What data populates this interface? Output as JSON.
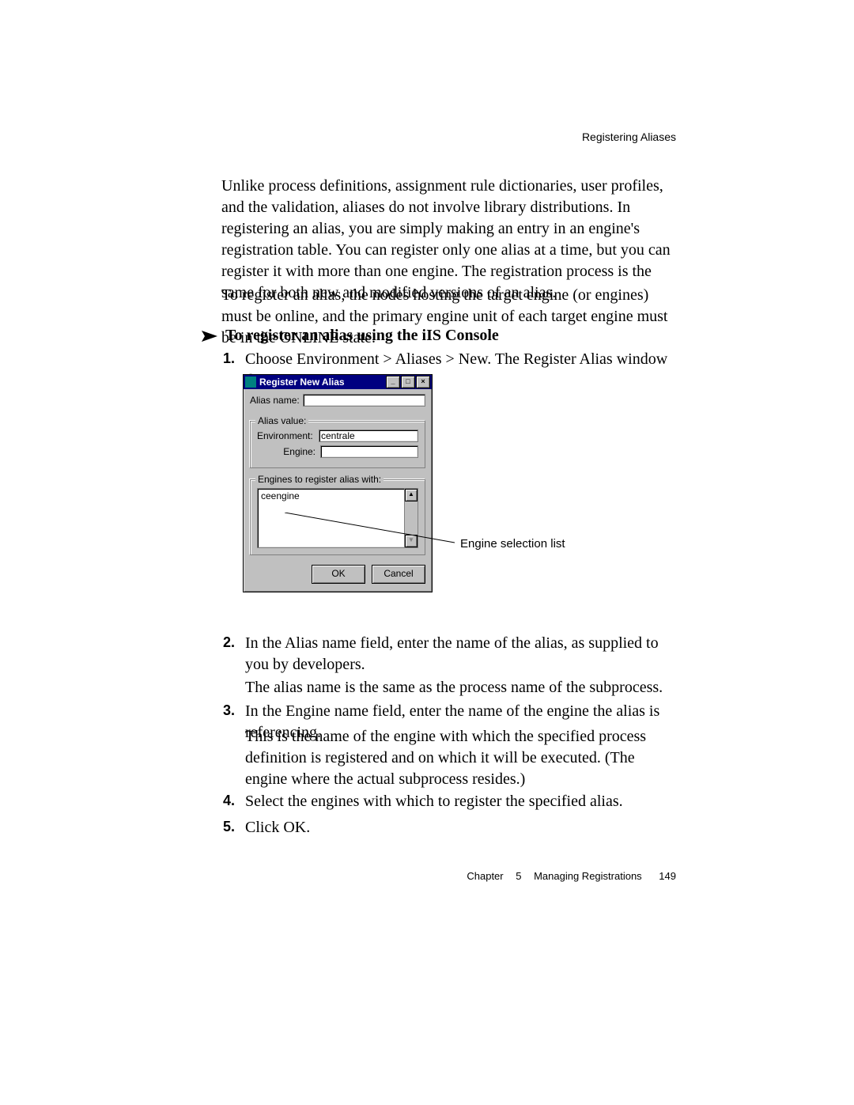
{
  "header": {
    "right": "Registering Aliases"
  },
  "paragraphs": {
    "p1": "Unlike process definitions, assignment rule dictionaries, user profiles, and the validation, aliases do not involve library distributions. In registering an alias, you are simply making an entry in an engine's registration table. You can register only one alias at a time, but you can register it with more than one engine. The registration process is the same for both new and modified versions of an alias.",
    "p2": "To register an alias, the nodes hosting the target engine (or engines) must be online, and the primary engine unit of each target engine must be in the ONLINE state."
  },
  "procedure": {
    "heading": "To register an alias using the iIS Console",
    "steps": {
      "s1": "Choose Environment > Aliases > New. The Register Alias window displays:",
      "s2": "In the Alias name field, enter the name of the alias, as supplied to you by developers.",
      "s2b": "The alias name is the same as the process name of the subprocess.",
      "s3": "In the Engine name field, enter the name of the engine the alias is referencing.",
      "s3b": "This is the name of the engine with which the specified process definition is registered and on which it will be executed. (The engine where the actual subprocess resides.)",
      "s4": "Select the engines with which to register the specified alias.",
      "s5": "Click OK."
    },
    "nums": {
      "n1": "1.",
      "n2": "2.",
      "n3": "3.",
      "n4": "4.",
      "n5": "5."
    }
  },
  "dialog": {
    "title": "Register New Alias",
    "alias_name_label": "Alias name:",
    "alias_name_value": "",
    "alias_value_group": "Alias value:",
    "environment_label": "Environment:",
    "environment_value": "centrale",
    "engine_label": "Engine:",
    "engine_value": "",
    "engines_group": "Engines to register alias with:",
    "engines_list_item": "ceengine",
    "ok_label": "OK",
    "cancel_label": "Cancel",
    "winbtn_min": "_",
    "winbtn_max": "□",
    "winbtn_close": "×",
    "scroll_up": "▲",
    "scroll_down": "▼"
  },
  "callout": {
    "text": "Engine selection list"
  },
  "footer": {
    "chapter_label": "Chapter",
    "chapter_num": "5",
    "chapter_title": "Managing Registrations",
    "page_num": "149"
  }
}
